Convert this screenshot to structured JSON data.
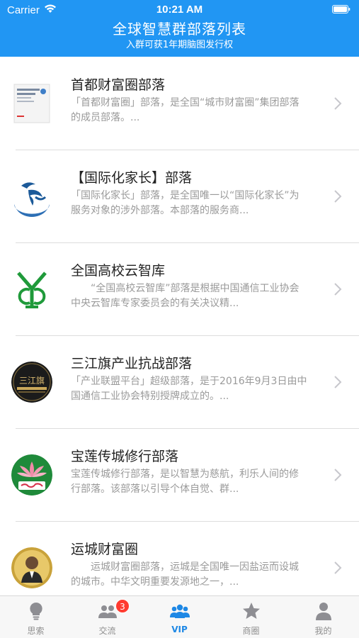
{
  "status_bar": {
    "carrier": "Carrier",
    "time": "10:21 AM"
  },
  "header": {
    "title": "全球智慧群部落列表",
    "subtitle": "入群可获1年期脑图发行权"
  },
  "items": [
    {
      "title": "首都财富圈部落",
      "desc": "「首都财富圈」部落，是全国“城市财富圈”集团部落的成员部落。..."
    },
    {
      "title": "【国际化家长】部落",
      "desc": "「国际化家长」部落，是全国唯一以“国际化家长”为服务对象的涉外部落。本部落的服务商..."
    },
    {
      "title": "全国高校云智库",
      "desc": "　　“全国高校云智库”部落是根据中国通信工业协会中央云智库专家委员会的有关决议精..."
    },
    {
      "title": "三江旗产业抗战部落",
      "desc": "「产业联盟平台」超级部落，是于2016年9月3日由中国通信工业协会特别授牌成立的。..."
    },
    {
      "title": "宝莲传城修行部落",
      "desc": "宝莲传城修行部落，是以智慧为慈航，利乐人间的修行部落。该部落以引导个体自觉、群..."
    },
    {
      "title": "运城财富圈",
      "desc": "　　运城财富圈部落，运城是全国唯一因盐运而设城的城市。中华文明重要发源地之一，..."
    }
  ],
  "logos": {
    "item4_text": "三江旗"
  },
  "tabs": [
    {
      "label": "思索",
      "icon": "lightbulb-icon"
    },
    {
      "label": "交流",
      "icon": "people-icon",
      "badge": "3"
    },
    {
      "label": "VIP",
      "icon": "group-icon",
      "active": true
    },
    {
      "label": "商圈",
      "icon": "star-icon"
    },
    {
      "label": "我的",
      "icon": "person-icon"
    }
  ],
  "colors": {
    "header": "#2196f3",
    "active_tab": "#1e88e5",
    "badge": "#ff3b30"
  }
}
